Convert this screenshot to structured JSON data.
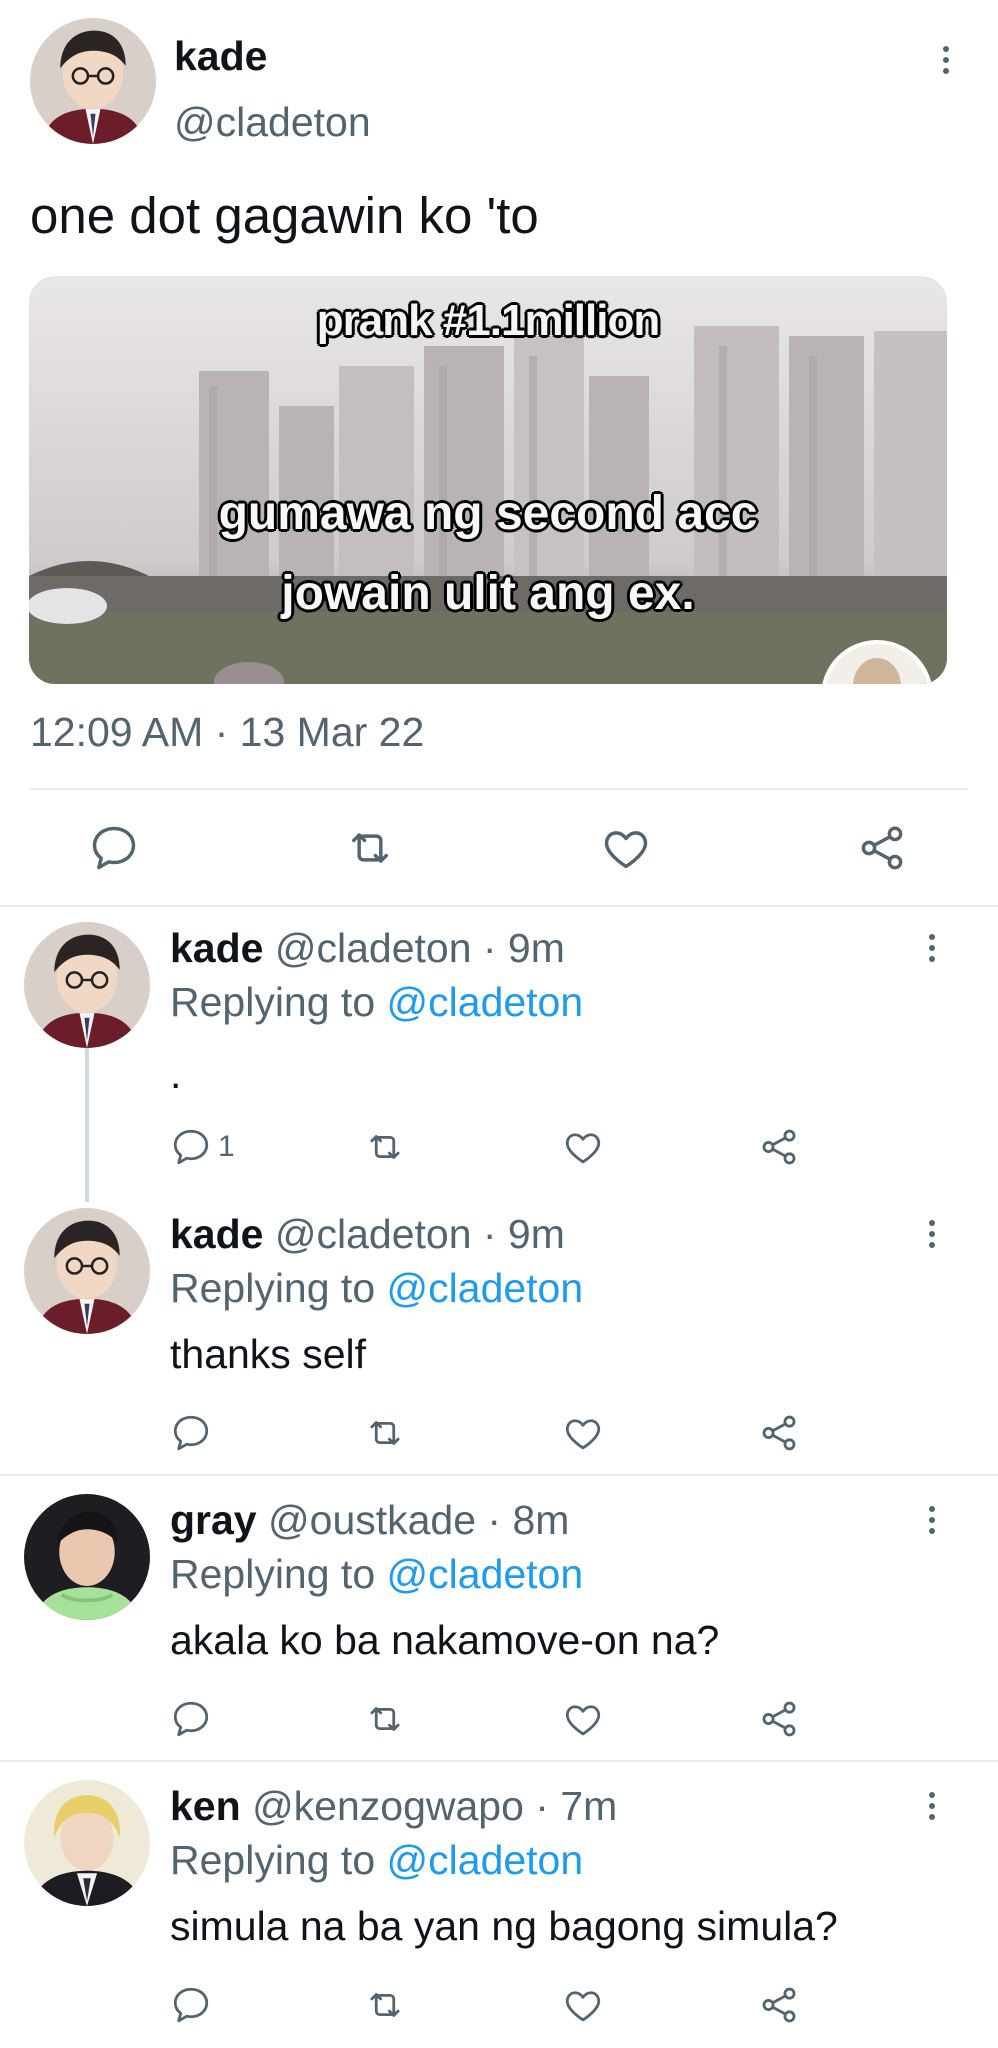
{
  "main_tweet": {
    "display_name": "kade",
    "handle": "@cladeton",
    "text": "one dot gagawin ko 'to",
    "media_caption_top": "prank #1.1million",
    "media_caption_line1": "gumawa ng second acc",
    "media_caption_line2": "jowain ulit ang ex.",
    "timestamp": "12:09 AM · 13 Mar 22"
  },
  "replies": [
    {
      "display_name": "kade",
      "meta": "@cladeton · 9m",
      "replying_label": "Replying to",
      "replying_handle": "@cladeton",
      "text": ".",
      "reply_count": "1"
    },
    {
      "display_name": "kade",
      "meta": "@cladeton · 9m",
      "replying_label": "Replying to",
      "replying_handle": "@cladeton",
      "text": "thanks self",
      "reply_count": ""
    },
    {
      "display_name": "gray",
      "meta": "@oustkade · 8m",
      "replying_label": "Replying to",
      "replying_handle": "@cladeton",
      "text": "akala ko ba nakamove-on na?",
      "reply_count": ""
    },
    {
      "display_name": "ken",
      "meta": "@kenzogwapo · 7m",
      "replying_label": "Replying to",
      "replying_handle": "@cladeton",
      "text": "simula na ba yan ng bagong simula?",
      "reply_count": ""
    }
  ],
  "icons": {
    "reply": "speech-bubble-icon",
    "retweet": "retweet-arrows-icon",
    "like": "heart-icon",
    "share": "share-nodes-icon",
    "more": "vertical-dots-icon"
  },
  "colors": {
    "link": "#1d9bf0",
    "muted": "#536471",
    "text": "#0f1419",
    "divider": "#e9ecef"
  }
}
